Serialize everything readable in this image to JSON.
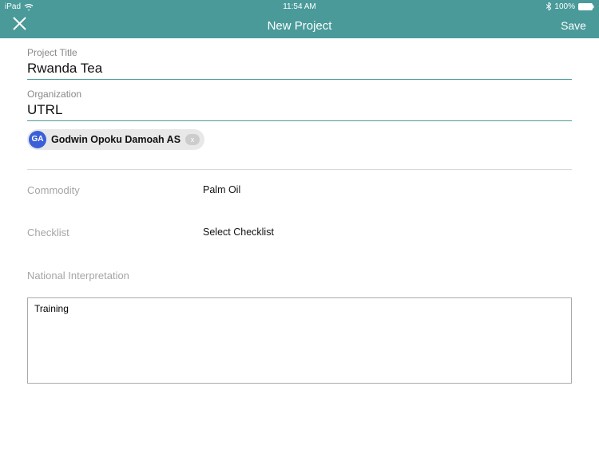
{
  "status": {
    "device": "iPad",
    "time": "11:54 AM",
    "battery": "100%"
  },
  "nav": {
    "title": "New Project",
    "save_label": "Save"
  },
  "form": {
    "project_title_label": "Project Title",
    "project_title_value": "Rwanda Tea",
    "organization_label": "Organization",
    "organization_value": "UTRL",
    "chip": {
      "initials": "GA",
      "name": "Godwin Opoku Damoah AS",
      "remove": "x"
    },
    "commodity_label": "Commodity",
    "commodity_value": "Palm Oil",
    "checklist_label": "Checklist",
    "checklist_value": "Select Checklist",
    "national_label": "National Interpretation",
    "national_value": "Training"
  }
}
